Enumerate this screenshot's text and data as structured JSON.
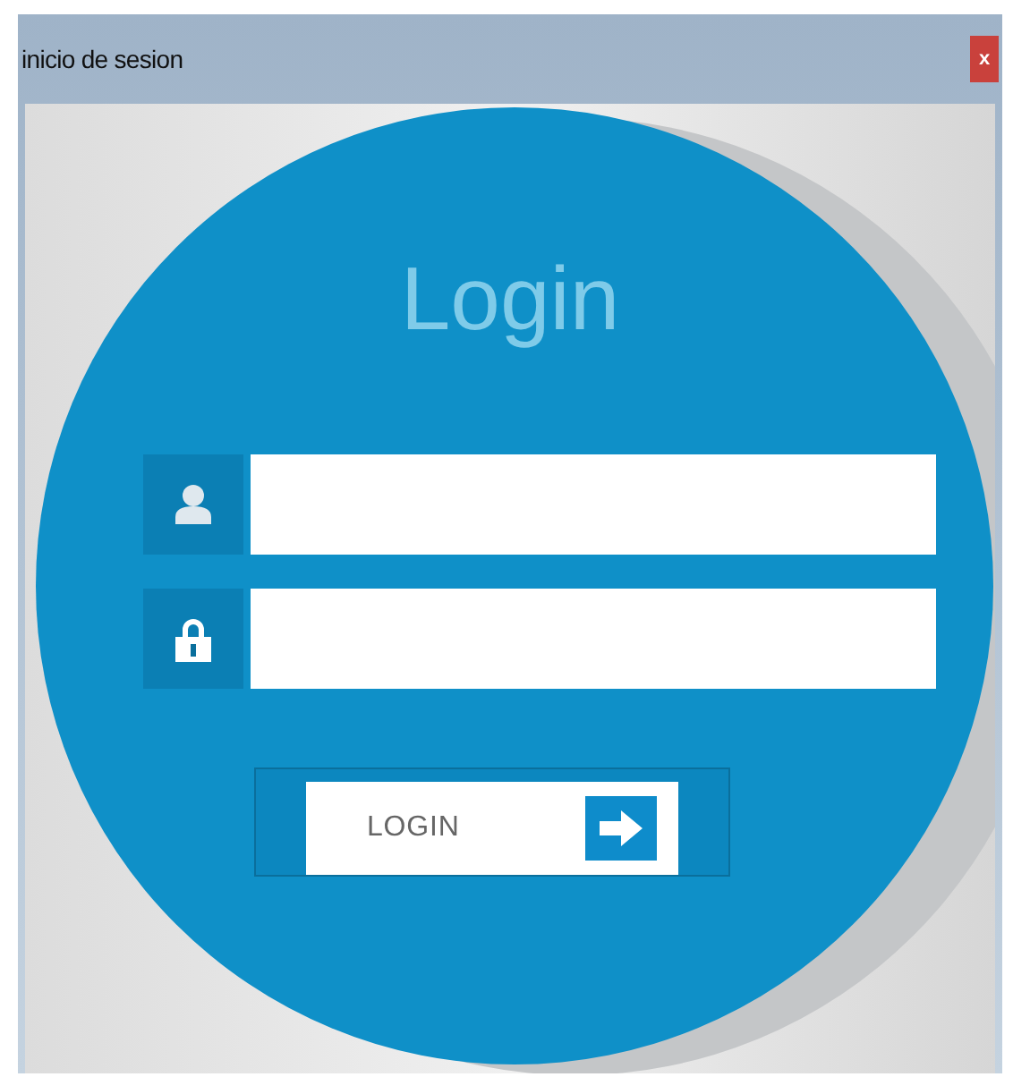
{
  "window": {
    "title": "inicio de sesion",
    "close": "x"
  },
  "heading": "Login",
  "fields": [
    {
      "kind": "user"
    },
    {
      "kind": "password"
    }
  ],
  "button": {
    "label": "LOGIN"
  }
}
